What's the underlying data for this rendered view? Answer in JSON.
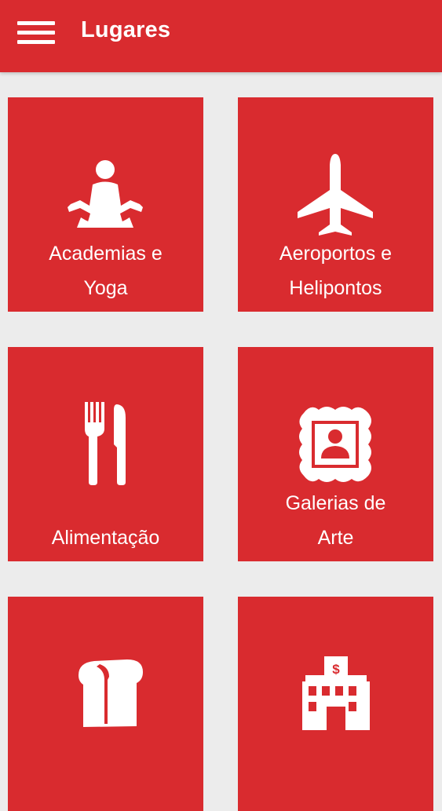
{
  "header": {
    "title": "Lugares",
    "menu_icon": "hamburger-menu-icon"
  },
  "colors": {
    "primary": "#d92b2f",
    "background": "#ececec",
    "icon": "#ffffff"
  },
  "tiles": [
    {
      "label": "Academias e\nYoga",
      "icon": "yoga-pose-icon"
    },
    {
      "label": "Aeroportos e\nHelipontos",
      "icon": "airplane-icon"
    },
    {
      "label": "Alimentação",
      "icon": "fork-knife-icon"
    },
    {
      "label": "Galerias de\nArte",
      "icon": "framed-portrait-icon"
    },
    {
      "label": "",
      "icon": "bread-loaf-icon"
    },
    {
      "label": "",
      "icon": "bank-building-icon"
    }
  ]
}
